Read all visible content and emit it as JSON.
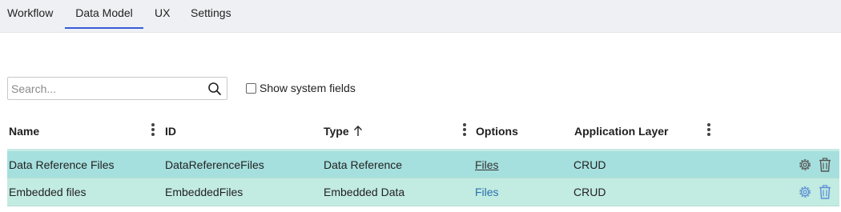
{
  "tabs": [
    {
      "label": "Workflow",
      "active": false
    },
    {
      "label": "Data Model",
      "active": true
    },
    {
      "label": "UX",
      "active": false
    },
    {
      "label": "Settings",
      "active": false
    }
  ],
  "search": {
    "placeholder": "Search...",
    "value": ""
  },
  "show_system_fields": {
    "label": "Show system fields",
    "checked": false
  },
  "columns": {
    "name": "Name",
    "id": "ID",
    "type": "Type",
    "options": "Options",
    "application_layer": "Application Layer"
  },
  "sort": {
    "column": "Type",
    "direction": "ascending",
    "icon": "arrow-up-icon"
  },
  "rows": [
    {
      "name": "Data Reference Files",
      "id": "DataReferenceFiles",
      "type": "Data Reference",
      "options": "Files",
      "application_layer": "CRUD"
    },
    {
      "name": "Embedded files",
      "id": "EmbeddedFiles",
      "type": "Embedded Data",
      "options": "Files",
      "application_layer": "CRUD"
    }
  ],
  "colors": {
    "accent": "#3a5bd9",
    "row_selected": "#a5e0de",
    "row_highlight": "#c2ebe1",
    "link": "#2a6fb0"
  }
}
